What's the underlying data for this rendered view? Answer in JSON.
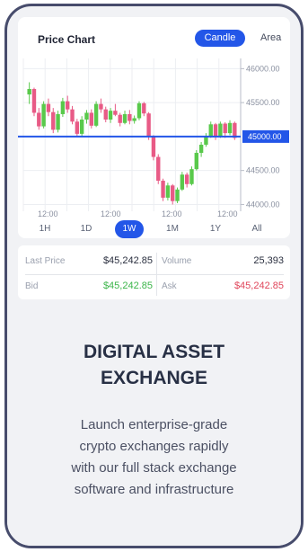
{
  "chart": {
    "title": "Price Chart",
    "toggle": [
      "Candle",
      "Area"
    ],
    "current_price_label": "45000.00",
    "y_ticks": [
      "46000.00",
      "45500.00",
      "45000.00",
      "44500.00",
      "44000.00"
    ],
    "x_ticks": [
      "12:00",
      "12:00",
      "12:00",
      "12:00"
    ],
    "timeframes": [
      "1H",
      "1D",
      "1W",
      "1M",
      "1Y",
      "All"
    ],
    "active_timeframe": "1W",
    "up_color": "#59c94b",
    "down_color": "#e85a86",
    "price_line_color": "#2356e8"
  },
  "stats": {
    "last_price_label": "Last Price",
    "last_price": "$45,242.85",
    "volume_label": "Volume",
    "volume": "25,393",
    "bid_label": "Bid",
    "bid": "$45,242.85",
    "ask_label": "Ask",
    "ask": "$45,242.85"
  },
  "hero": {
    "title_line1": "DIGITAL ASSET",
    "title_line2": "EXCHANGE",
    "desc_lines": [
      "Launch enterprise-grade",
      "crypto exchanges rapidly",
      "with our full stack exchange",
      "software and infrastructure"
    ]
  },
  "chart_data": {
    "type": "candlestick",
    "ylim": [
      43900,
      46150
    ],
    "candles": [
      [
        45620,
        45800,
        45480,
        45700
      ],
      [
        45700,
        45720,
        45300,
        45350
      ],
      [
        45350,
        45420,
        45100,
        45150
      ],
      [
        45150,
        45520,
        45120,
        45480
      ],
      [
        45480,
        45560,
        45300,
        45360
      ],
      [
        45360,
        45420,
        45050,
        45100
      ],
      [
        45100,
        45380,
        45060,
        45330
      ],
      [
        45330,
        45570,
        45290,
        45520
      ],
      [
        45520,
        45600,
        45350,
        45400
      ],
      [
        45400,
        45450,
        45180,
        45220
      ],
      [
        45220,
        45260,
        45000,
        45040
      ],
      [
        45040,
        45300,
        45010,
        45250
      ],
      [
        45250,
        45390,
        45190,
        45350
      ],
      [
        45350,
        45400,
        45120,
        45160
      ],
      [
        45160,
        45520,
        45140,
        45480
      ],
      [
        45480,
        45560,
        45350,
        45400
      ],
      [
        45400,
        45440,
        45210,
        45250
      ],
      [
        45250,
        45420,
        45200,
        45380
      ],
      [
        45380,
        45480,
        45300,
        45320
      ],
      [
        45320,
        45350,
        45150,
        45200
      ],
      [
        45200,
        45380,
        45180,
        45330
      ],
      [
        45330,
        45390,
        45180,
        45230
      ],
      [
        45230,
        45310,
        45190,
        45270
      ],
      [
        45270,
        45520,
        45240,
        45490
      ],
      [
        45490,
        45510,
        45300,
        45340
      ],
      [
        45340,
        45360,
        44950,
        45000
      ],
      [
        45000,
        45020,
        44650,
        44700
      ],
      [
        44700,
        44740,
        44300,
        44350
      ],
      [
        44350,
        44380,
        44050,
        44100
      ],
      [
        44100,
        44320,
        44060,
        44280
      ],
      [
        44280,
        44300,
        44000,
        44050
      ],
      [
        44050,
        44250,
        44020,
        44220
      ],
      [
        44220,
        44480,
        44200,
        44440
      ],
      [
        44440,
        44470,
        44250,
        44300
      ],
      [
        44300,
        44560,
        44280,
        44520
      ],
      [
        44520,
        44800,
        44500,
        44760
      ],
      [
        44760,
        44920,
        44700,
        44880
      ],
      [
        44880,
        45050,
        44850,
        45000
      ],
      [
        45000,
        45220,
        44980,
        45180
      ],
      [
        45180,
        45200,
        44950,
        45000
      ],
      [
        45000,
        45220,
        44980,
        45190
      ],
      [
        45190,
        45210,
        44980,
        45050
      ],
      [
        45050,
        45240,
        45020,
        45200
      ],
      [
        45200,
        45220,
        44950,
        44980
      ]
    ]
  }
}
